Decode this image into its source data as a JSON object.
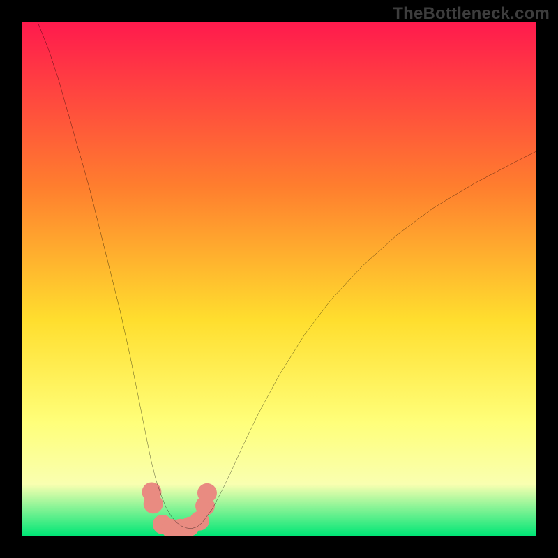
{
  "watermark": "TheBottleneck.com",
  "chart_data": {
    "type": "line",
    "title": "",
    "xlabel": "",
    "ylabel": "",
    "xlim": [
      0,
      100
    ],
    "ylim": [
      0,
      100
    ],
    "grid": false,
    "legend": false,
    "background_gradient": {
      "top": "#ff1a4d",
      "mid1": "#ff7e2e",
      "mid2": "#ffde2e",
      "mid3": "#ffff7a",
      "low": "#f9ffb0",
      "bottom": "#00e676"
    },
    "series": [
      {
        "name": "curve",
        "color": "#000000",
        "stroke_width": 2.4,
        "x": [
          3,
          5,
          7,
          9,
          11,
          13,
          15,
          17,
          19,
          21,
          23,
          24,
          25,
          26,
          27,
          28,
          29,
          30,
          31,
          32,
          33,
          34,
          35,
          37,
          39,
          41,
          43,
          46,
          50,
          55,
          60,
          66,
          73,
          80,
          88,
          96,
          100
        ],
        "y": [
          100,
          95,
          89,
          82,
          75,
          68,
          60,
          52,
          44,
          35,
          25,
          20,
          15,
          11,
          8,
          5.5,
          3.8,
          2.6,
          1.9,
          1.5,
          1.4,
          1.7,
          2.5,
          5.2,
          9,
          13.2,
          17.6,
          23.8,
          31.2,
          39.2,
          45.8,
          52.3,
          58.6,
          63.8,
          68.6,
          72.8,
          74.8
        ]
      },
      {
        "name": "highlight-nodes",
        "color": "#e98b81",
        "type": "scatter",
        "marker_size": 28,
        "x": [
          25.2,
          25.5,
          27.3,
          29.0,
          30.8,
          32.6,
          34.5,
          35.6,
          36.0
        ],
        "y": [
          8.5,
          6.2,
          2.2,
          1.4,
          1.4,
          1.8,
          2.9,
          5.8,
          8.3
        ]
      }
    ]
  }
}
